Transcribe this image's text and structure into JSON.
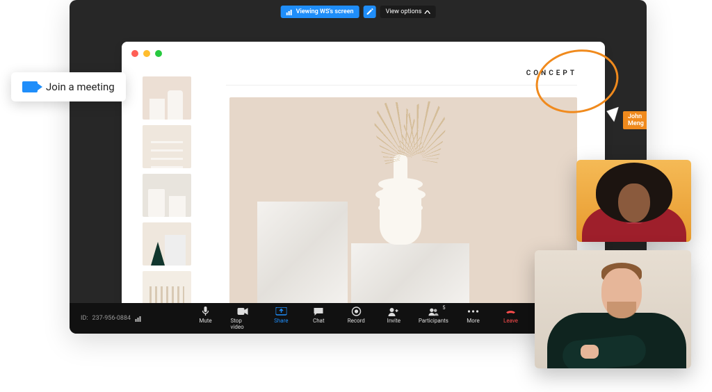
{
  "top": {
    "viewing_label": "Viewing WS's screen",
    "view_options_label": "View options"
  },
  "shared": {
    "concept_label": "CONCEPT"
  },
  "annotation": {
    "cursor_name": "John Meng"
  },
  "status": {
    "meeting_id_prefix": "ID:",
    "meeting_id": "237-956-0884"
  },
  "toolbar": {
    "mute": "Mute",
    "stop_video": "Stop video",
    "share": "Share",
    "chat": "Chat",
    "record": "Record",
    "invite": "Invite",
    "participants": "Participants",
    "participants_count": "5",
    "more": "More",
    "leave": "Leave"
  },
  "join": {
    "label": "Join a meeting"
  }
}
